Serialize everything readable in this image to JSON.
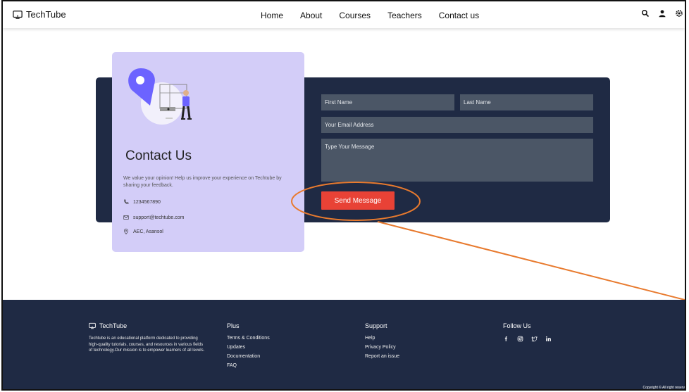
{
  "navbar": {
    "brand": "TechTube",
    "links": [
      "Home",
      "About",
      "Courses",
      "Teachers",
      "Contact us"
    ],
    "icons": [
      "search-icon",
      "user-icon",
      "settings-icon"
    ]
  },
  "contact": {
    "title": "Contact Us",
    "description": "We value your opinion! Help us improve your experience on Techtube by sharing your feedback.",
    "phone": "1234567890",
    "email": "support@techtube.com",
    "location": "AEC, Asansol"
  },
  "form": {
    "first_name_placeholder": "First Name",
    "last_name_placeholder": "Last Name",
    "email_placeholder": "Your Email Address",
    "message_placeholder": "Type Your Message",
    "send_label": "Send Message"
  },
  "footer": {
    "brand": "TechTube",
    "about": "Techtube is an educational platform dedicated to providing high-quality tutorials, courses, and resources in various fields of technology.Our mission is to empower learners of all levels.",
    "plus": {
      "heading": "Plus",
      "items": [
        "Terms & Conditions",
        "Updates",
        "Documentation",
        "FAQ"
      ]
    },
    "support": {
      "heading": "Support",
      "items": [
        "Help",
        "Privacy Policy",
        "Report an issue"
      ]
    },
    "follow": {
      "heading": "Follow Us",
      "icons": [
        "facebook-icon",
        "instagram-icon",
        "twitter-icon",
        "linkedin-icon"
      ]
    },
    "copyright": "Copyright © All right reserv"
  },
  "colors": {
    "navy": "#1f2a44",
    "card_lavender": "#d3cdf8",
    "field_gray": "#4b5666",
    "send_red": "#e84236",
    "annotation_orange": "#e87a2e"
  }
}
